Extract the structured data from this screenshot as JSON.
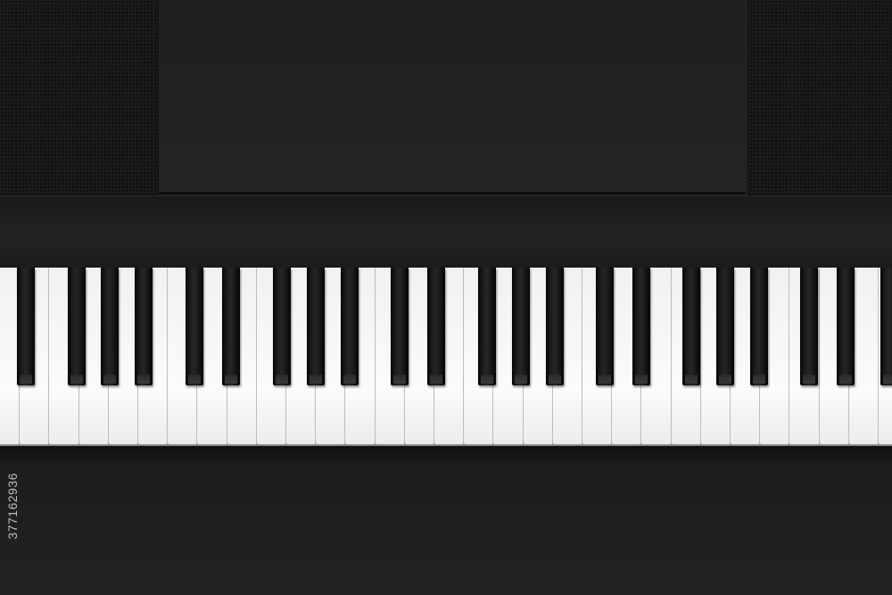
{
  "scene": {
    "subject": "digital-piano-top-view",
    "colors": {
      "body": "#202022",
      "speaker_grille": "#1b1b1d",
      "white_key": "#f6f6f6",
      "black_key": "#111111"
    }
  },
  "keyboard": {
    "visible_white_keys": 30,
    "visible_black_keys": 21
  },
  "watermark": {
    "id_text": "377162936"
  }
}
